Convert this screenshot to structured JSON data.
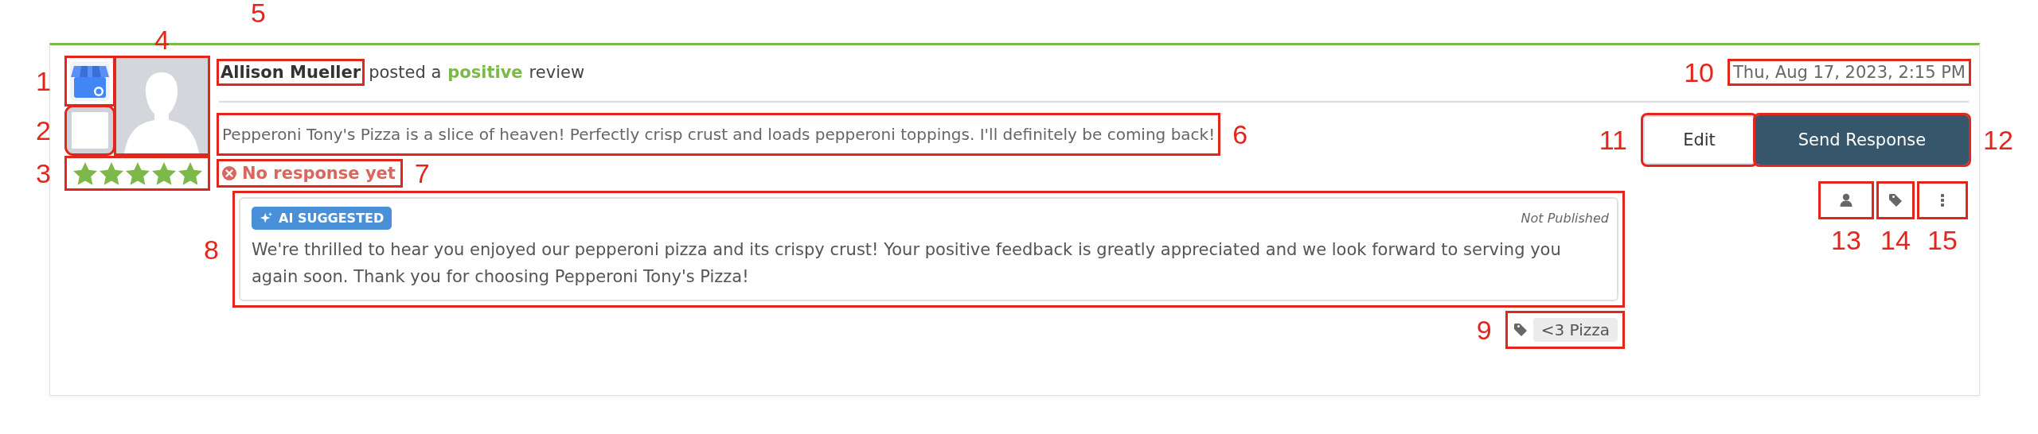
{
  "source": {
    "callout": "1"
  },
  "checkbox": {
    "checked": false,
    "callout": "2"
  },
  "rating": {
    "stars": 5,
    "callout": "3"
  },
  "avatar": {
    "callout": "4"
  },
  "reviewer": {
    "name": "Allison Mueller",
    "callout": "5",
    "verb": "posted a",
    "sentiment": "positive",
    "positive": true,
    "suffix": "review"
  },
  "date": {
    "text": "Thu, Aug 17, 2023, 2:15 PM",
    "callout": "10"
  },
  "review_text": {
    "text": "Pepperoni Tony's Pizza is a slice of heaven! Perfectly crisp crust and loads pepperoni toppings. I'll definitely be coming back!",
    "callout": "6"
  },
  "response_status": {
    "text": "No response yet",
    "responded": false,
    "callout": "7"
  },
  "suggestion": {
    "badge": "AI SUGGESTED",
    "status": "Not Published",
    "text": "We're thrilled to hear you enjoyed our pepperoni pizza and its crispy crust! Your positive feedback is greatly appreciated and we look forward to serving you again soon. Thank you for choosing Pepperoni Tony's Pizza!",
    "callout": "8"
  },
  "tags": [
    {
      "label": "<3 Pizza",
      "callout": "9"
    }
  ],
  "buttons": [
    {
      "label": "Edit",
      "kind": "secondary",
      "callout": "11"
    },
    {
      "label": "Send Response",
      "kind": "primary",
      "callout": "12"
    }
  ],
  "icon_buttons": [
    {
      "kind": "person",
      "callout": "13"
    },
    {
      "kind": "tag",
      "callout": "14"
    },
    {
      "kind": "more",
      "callout": "15"
    }
  ]
}
